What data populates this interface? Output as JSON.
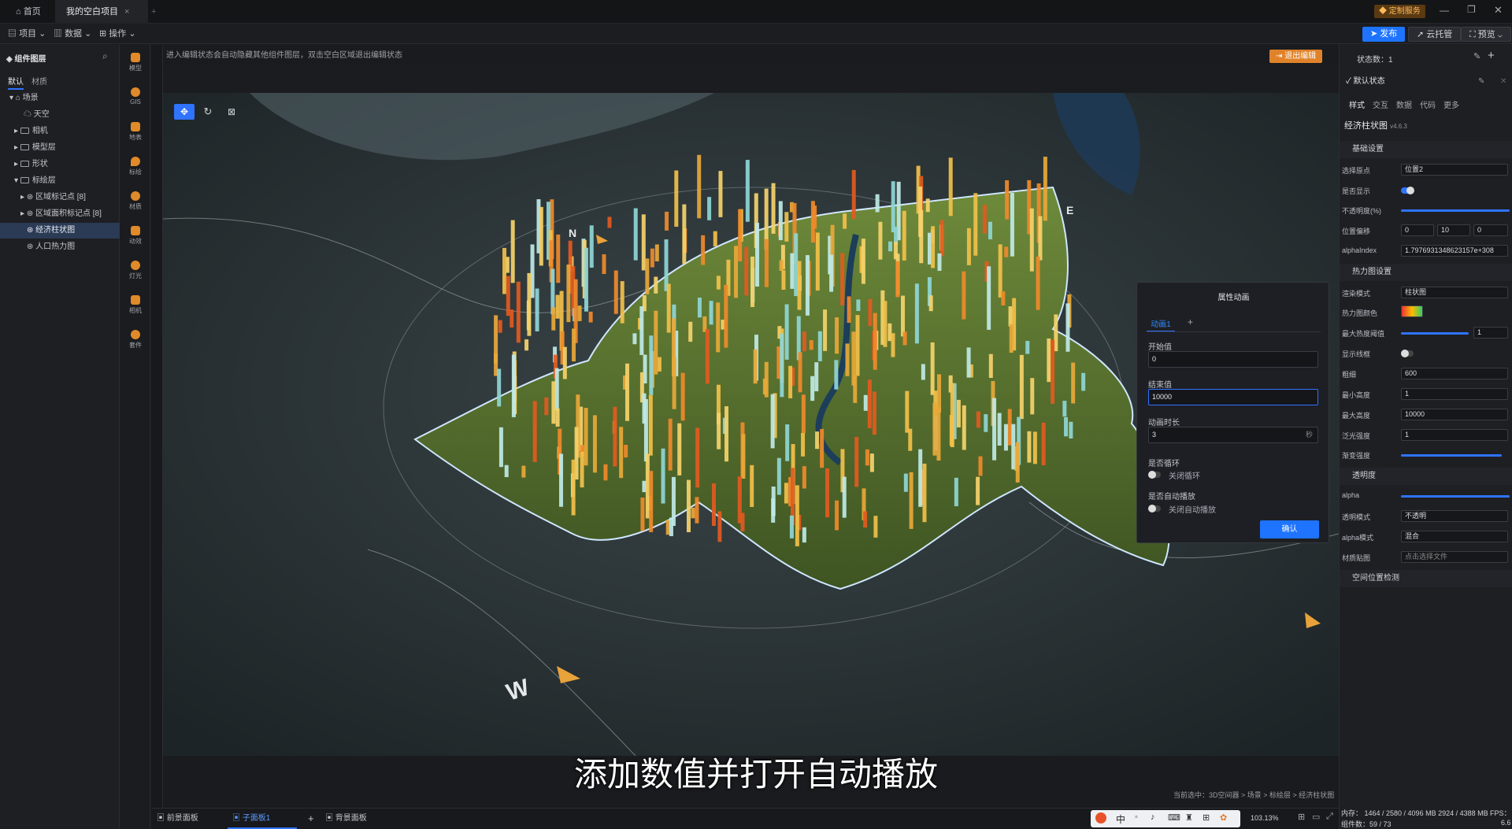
{
  "tabs": {
    "home": "首页",
    "project": "我的空白项目",
    "project_close": "×",
    "add": "+"
  },
  "top_right": {
    "custom_service": "定制服务"
  },
  "menu": {
    "project": "项目",
    "data": "数据",
    "operate": "操作"
  },
  "actions": {
    "publish": "发布",
    "cloud": "云托管",
    "preview": "预览"
  },
  "left": {
    "title": "组件图层",
    "tab_default": "默认",
    "tab_material": "材质",
    "tree": [
      "场景",
      "天空",
      "相机",
      "模型层",
      "形状",
      "标绘层",
      "区域标记点 [8]",
      "区域面积标记点 [8]",
      "经济柱状图",
      "人口热力图"
    ]
  },
  "strip": [
    "模型",
    "GIS",
    "地表",
    "标绘",
    "材质",
    "动效",
    "灯光",
    "相机",
    "套件"
  ],
  "hint": "进入编辑状态会自动隐藏其他组件图层，双击空白区域退出编辑状态",
  "exit_edit": "退出编辑",
  "compass": {
    "north": "N",
    "east": "E",
    "west": "W"
  },
  "dialog": {
    "title": "属性动画",
    "tab": "动画1",
    "add": "+",
    "start_label": "开始值",
    "start_value": "0",
    "end_label": "结束值",
    "end_value": "10000",
    "duration_label": "动画时长",
    "duration_value": "3",
    "duration_unit": "秒",
    "loop_label": "是否循环",
    "loop_state": "关闭循环",
    "autoplay_label": "是否自动播放",
    "autoplay_state": "关闭自动播放",
    "confirm": "确认"
  },
  "right": {
    "state_count": "状态数：1",
    "default_state": "默认状态",
    "tabs": [
      "样式",
      "交互",
      "数据",
      "代码",
      "更多"
    ],
    "component": "经济柱状图",
    "version": "v4.6.3",
    "basic_section": "基础设置",
    "select_origin_label": "选择原点",
    "select_origin_value": "位置2",
    "visible_label": "是否显示",
    "opacity_label": "不透明度(%)",
    "offset_label": "位置偏移",
    "offset": [
      "0",
      "10",
      "0"
    ],
    "alpha_index_label": "alphaIndex",
    "alpha_index_value": "1.7976931348623157e+308",
    "heat_section": "热力图设置",
    "render_mode_label": "渲染模式",
    "render_mode_value": "柱状图",
    "heat_color_label": "热力图颜色",
    "max_heat_label": "最大热度阈值",
    "max_heat_value": "1",
    "show_wire_label": "显示线框",
    "thickness_label": "粗细",
    "thickness_value": "600",
    "min_height_label": "最小高度",
    "min_height_value": "1",
    "max_height_label": "最大高度",
    "max_height_value": "10000",
    "glow_label": "泛光强度",
    "glow_value": "1",
    "gradient_label": "渐变强度",
    "transparency_section": "透明度",
    "alpha_label": "alpha",
    "trans_mode_label": "透明模式",
    "trans_mode_value": "不透明",
    "alpha_mode_label": "alpha模式",
    "alpha_mode_value": "混合",
    "texture_label": "材质贴图",
    "texture_value": "点击选择文件",
    "space_section": "空间位置检测"
  },
  "bottom": {
    "front": "前景面板",
    "sub": "子面板1",
    "add": "+",
    "back": "背景面板",
    "zoom": "103.13%",
    "memory": "内存： 1464 / 2580 / 4096 MB 2924 / 4388 MB",
    "fps": "FPS： 6",
    "components": "组件数：59 / 73",
    "fps2": "6.6"
  },
  "breadcrumb": "当前选中：3D空间器 > 场景 > 标绘层 > 经济柱状图",
  "subtitle": "添加数值并打开自动播放",
  "tray": {
    "ime": "中"
  }
}
